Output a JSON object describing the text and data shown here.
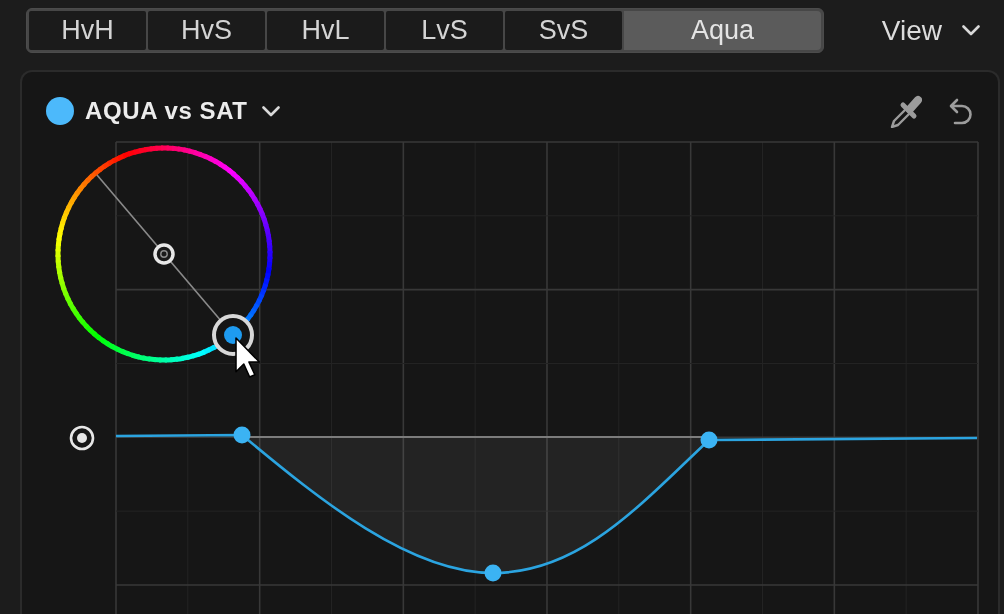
{
  "tabs": [
    {
      "label": "HvH",
      "selected": false
    },
    {
      "label": "HvS",
      "selected": false
    },
    {
      "label": "HvL",
      "selected": false
    },
    {
      "label": "LvS",
      "selected": false
    },
    {
      "label": "SvS",
      "selected": false
    },
    {
      "label": "Aqua",
      "selected": true
    }
  ],
  "view_menu": {
    "label": "View"
  },
  "curve_panel": {
    "title": "AQUA vs SAT"
  }
}
